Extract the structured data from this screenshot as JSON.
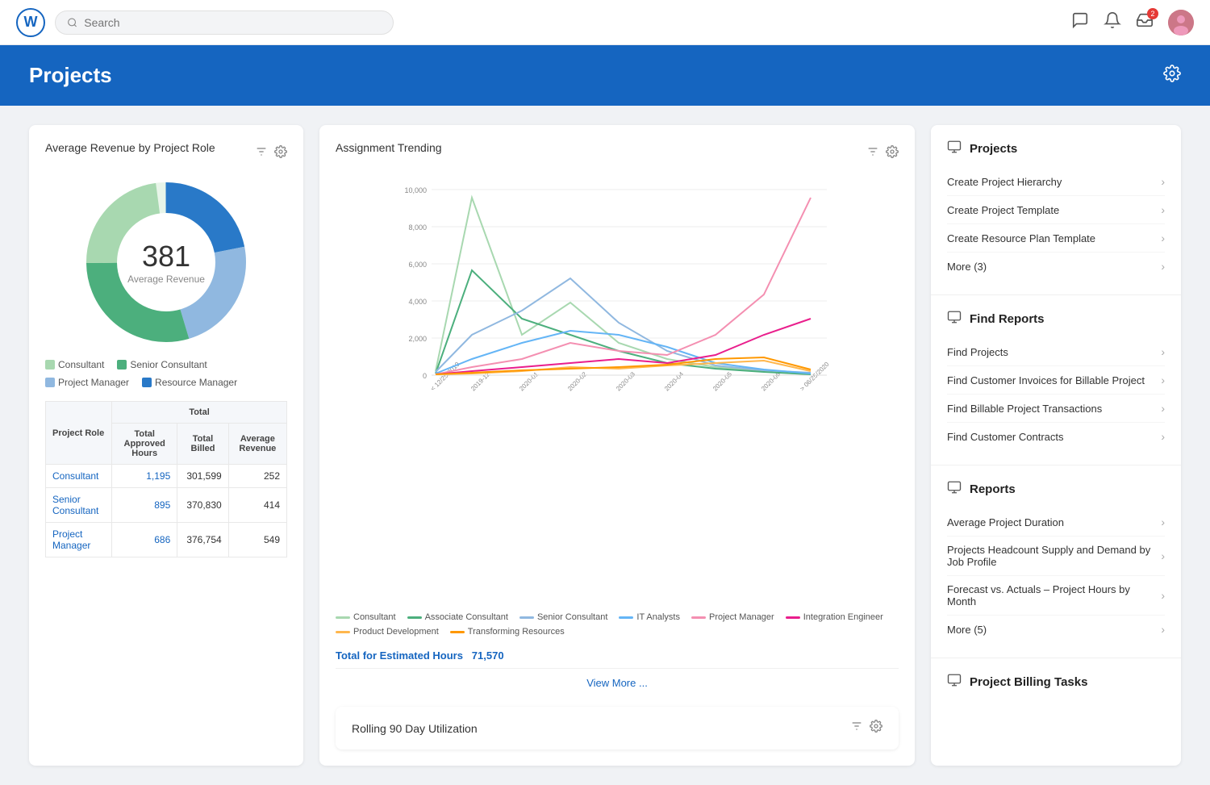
{
  "nav": {
    "search_placeholder": "Search",
    "message_icon": "💬",
    "bell_icon": "🔔",
    "inbox_icon": "📥",
    "badge_count": "2"
  },
  "page": {
    "title": "Projects",
    "gear_icon": "⚙"
  },
  "left_widget": {
    "title": "Average Revenue by Project Role",
    "donut_value": "381",
    "donut_subtitle": "Average Revenue",
    "legend": [
      {
        "label": "Consultant",
        "color": "#a8d8b0"
      },
      {
        "label": "Senior Consultant",
        "color": "#4caf7d"
      },
      {
        "label": "Project Manager",
        "color": "#90b8e0"
      },
      {
        "label": "Resource Manager",
        "color": "#2979c8"
      }
    ],
    "table": {
      "headers": [
        "Project Role",
        "Total Approved Hours",
        "Total Billed",
        "Average Revenue"
      ],
      "total_header": "Total",
      "rows": [
        {
          "role": "Consultant",
          "hours": "1,195",
          "billed": "301,599",
          "avg_rev": "252"
        },
        {
          "role": "Senior Consultant",
          "hours": "895",
          "billed": "370,830",
          "avg_rev": "414"
        },
        {
          "role": "Project Manager",
          "hours": "686",
          "billed": "376,754",
          "avg_rev": "549"
        }
      ]
    }
  },
  "middle_widget": {
    "title": "Assignment Trending",
    "y_labels": [
      "10,000",
      "8,000",
      "6,000",
      "4,000",
      "2,000",
      "0"
    ],
    "x_labels": [
      "< 12/25/2019",
      "2019-12",
      "2020-01",
      "2020-02",
      "2020-03",
      "2020-04",
      "2020-05",
      "2020-06",
      "> 06/25/2020"
    ],
    "legend": [
      {
        "label": "Consultant",
        "color": "#a8d8b0"
      },
      {
        "label": "Associate Consultant",
        "color": "#4caf7d"
      },
      {
        "label": "Senior Consultant",
        "color": "#90b8e0"
      },
      {
        "label": "IT Analysts",
        "color": "#64b5f6"
      },
      {
        "label": "Project Manager",
        "color": "#f48fb1"
      },
      {
        "label": "Integration Engineer",
        "color": "#e91e8c"
      },
      {
        "label": "Product Development",
        "color": "#ffb74d"
      },
      {
        "label": "Transforming Resources",
        "color": "#ff9800"
      }
    ],
    "total_label": "Total for Estimated Hours",
    "total_value": "71,570",
    "view_more": "View More ..."
  },
  "rolling_widget": {
    "title": "Rolling 90 Day Utilization"
  },
  "right_panel": {
    "sections": [
      {
        "id": "projects",
        "heading": "Projects",
        "icon": "🗂",
        "items": [
          {
            "label": "Create Project Hierarchy"
          },
          {
            "label": "Create Project Template"
          },
          {
            "label": "Create Resource Plan Template"
          },
          {
            "label": "More (3)"
          }
        ]
      },
      {
        "id": "find-reports",
        "heading": "Find Reports",
        "icon": "🗂",
        "items": [
          {
            "label": "Find Projects"
          },
          {
            "label": "Find Customer Invoices for Billable Project"
          },
          {
            "label": "Find Billable Project Transactions"
          },
          {
            "label": "Find Customer Contracts"
          }
        ]
      },
      {
        "id": "reports",
        "heading": "Reports",
        "icon": "🗂",
        "items": [
          {
            "label": "Average Project Duration"
          },
          {
            "label": "Projects Headcount Supply and Demand by Job Profile"
          },
          {
            "label": "Forecast vs. Actuals – Project Hours by Month"
          },
          {
            "label": "More (5)"
          }
        ]
      },
      {
        "id": "project-billing",
        "heading": "Project Billing Tasks",
        "icon": "🗂",
        "items": []
      }
    ]
  }
}
